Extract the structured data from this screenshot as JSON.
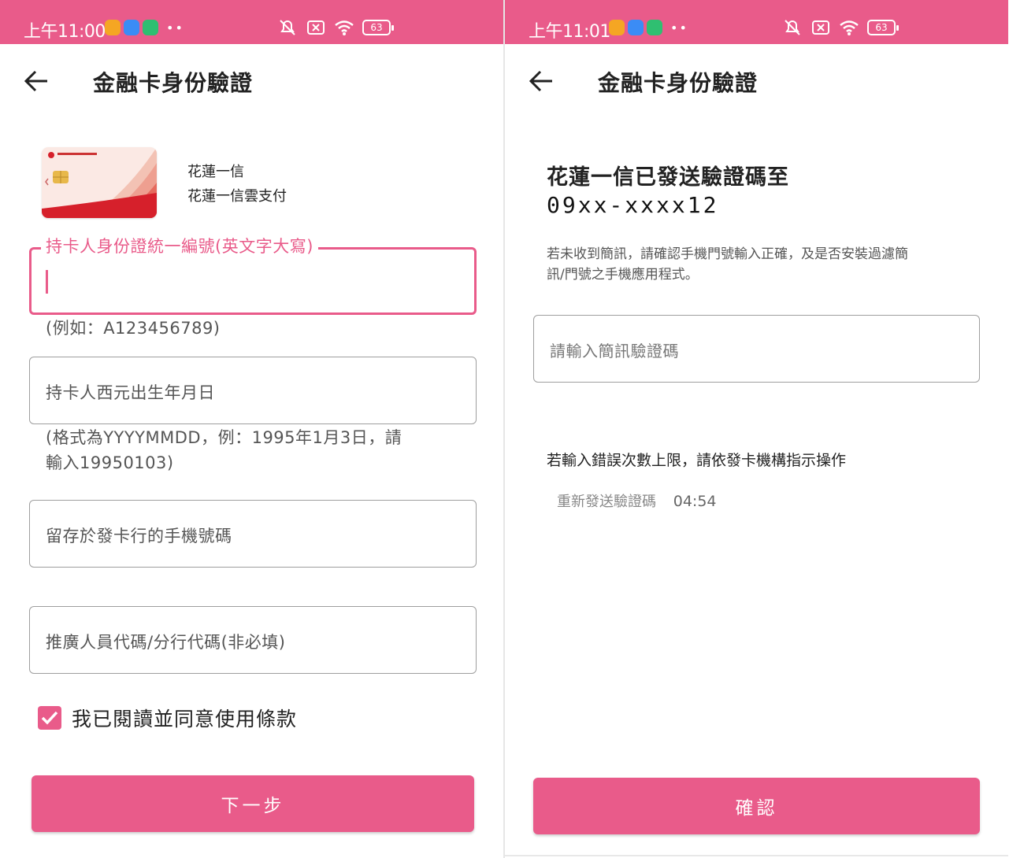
{
  "status_left": {
    "time": "上午11:00",
    "battery": "63"
  },
  "status_right": {
    "time": "上午11:01",
    "battery": "63"
  },
  "colors": {
    "accent": "#e95b8a",
    "border": "#9e9e9e"
  },
  "left_screen": {
    "title": "金融卡身份驗證",
    "card": {
      "bank_name": "花蓮一信",
      "product_name": "花蓮一信雲支付"
    },
    "id_field": {
      "label": "持卡人身份證統一編號(英文字大寫)",
      "value": "",
      "helper": "(例如：A123456789)"
    },
    "birth_field": {
      "placeholder": "持卡人西元出生年月日",
      "helper_line1": "(格式為YYYYMMDD，例：1995年1月3日，請",
      "helper_line2": "輸入19950103)"
    },
    "phone_field": {
      "placeholder": "留存於發卡行的手機號碼"
    },
    "referral_field": {
      "placeholder": "推廣人員代碼/分行代碼(非必填)"
    },
    "terms": {
      "label": "我已閱讀並同意使用條款",
      "checked": true
    },
    "next_button": "下一步"
  },
  "right_screen": {
    "title": "金融卡身份驗證",
    "sent_title": "花蓮一信已發送驗證碼至",
    "phone_masked": "09xx-xxxx12",
    "notice_line1": "若未收到簡訊，請確認手機門號輸入正確，及是否安裝過濾簡",
    "notice_line2": "訊/門號之手機應用程式。",
    "otp_placeholder": "請輸入簡訊驗證碼",
    "limit_text": "若輸入錯誤次數上限，請依發卡機構指示操作",
    "resend_label": "重新發送驗證碼",
    "countdown": "04:54",
    "confirm_button": "確認"
  }
}
